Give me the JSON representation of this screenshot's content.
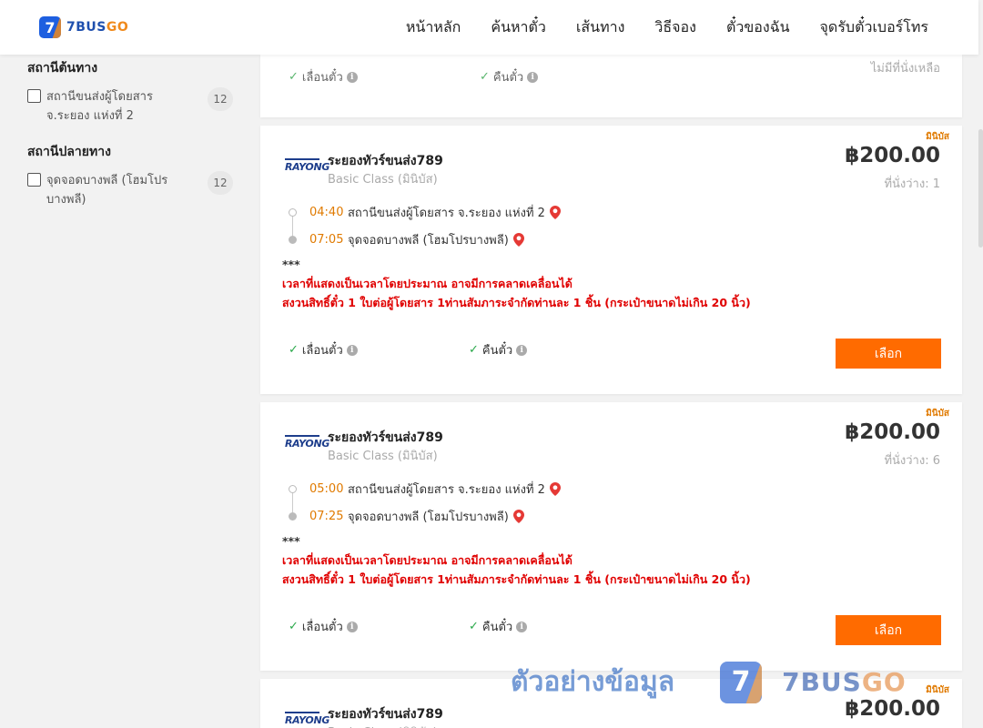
{
  "header": {
    "logo_digit": "7",
    "logo_text_main": "7BUS",
    "logo_text_accent": "GO",
    "nav": [
      "หน้าหลัก",
      "ค้นหาตั๋ว",
      "เส้นทาง",
      "วิธีจอง",
      "ตั๋วของฉัน",
      "จุดรับตั๋วเบอร์โทร"
    ]
  },
  "sidebar": {
    "origin_title": "สถานีต้นทาง",
    "origin_items": [
      {
        "label": "สถานีขนส่งผู้โดยสาร จ.ระยอง แห่งที่ 2",
        "count": "12"
      }
    ],
    "dest_title": "สถานีปลายทาง",
    "dest_items": [
      {
        "label": "จุดจอดบางพลี (โฮมโปรบางพลี)",
        "count": "12"
      }
    ]
  },
  "top_card": {
    "opt_change": "เลื่อนตั๋ว",
    "opt_refund": "คืนตั๋ว",
    "no_seat": "ไม่มีที่นั่งเหลือ"
  },
  "cards": [
    {
      "tag": "มินิบัส",
      "logo": "RAYONG",
      "operator": "ระยองทัวร์ขนส่ง789",
      "class": "Basic Class (มินิบัส)",
      "price": "฿200.00",
      "seats": "ที่นั่งว่าง: 1",
      "depart_time": "04:40",
      "depart_station": "สถานีขนส่งผู้โดยสาร จ.ระยอง แห่งที่ 2",
      "arrive_time": "07:05",
      "arrive_station": "จุดจอดบางพลี (โฮมโปรบางพลี)",
      "note_stars": "***",
      "note_line1": "เวลาที่แสดงเป็นเวลาโดยประมาณ อาจมีการคลาดเคลื่อนได้",
      "note_line2": "สงวนสิทธิ์ตั๋ว 1 ใบต่อผู้โดยสาร 1ท่านสัมภาระจำกัดท่านละ 1 ชิ้น (กระเป๋าขนาดไม่เกิน 20 นิ้ว)",
      "opt_change": "เลื่อนตั๋ว",
      "opt_refund": "คืนตั๋ว",
      "select": "เลือก"
    },
    {
      "tag": "มินิบัส",
      "logo": "RAYONG",
      "operator": "ระยองทัวร์ขนส่ง789",
      "class": "Basic Class (มินิบัส)",
      "price": "฿200.00",
      "seats": "ที่นั่งว่าง: 6",
      "depart_time": "05:00",
      "depart_station": "สถานีขนส่งผู้โดยสาร จ.ระยอง แห่งที่ 2",
      "arrive_time": "07:25",
      "arrive_station": "จุดจอดบางพลี (โฮมโปรบางพลี)",
      "note_stars": "***",
      "note_line1": "เวลาที่แสดงเป็นเวลาโดยประมาณ อาจมีการคลาดเคลื่อนได้",
      "note_line2": "สงวนสิทธิ์ตั๋ว 1 ใบต่อผู้โดยสาร 1ท่านสัมภาระจำกัดท่านละ 1 ชิ้น (กระเป๋าขนาดไม่เกิน 20 นิ้ว)",
      "opt_change": "เลื่อนตั๋ว",
      "opt_refund": "คืนตั๋ว",
      "select": "เลือก"
    },
    {
      "tag": "มินิบัส",
      "logo": "RAYONG",
      "operator": "ระยองทัวร์ขนส่ง789",
      "class": "Basic Class (มินิบัส)",
      "price": "฿200.00"
    }
  ],
  "watermark": {
    "text": "ตัวอย่างข้อมูล",
    "logo_digit": "7",
    "brand_main": "7BUS",
    "brand_accent": "GO"
  },
  "colors": {
    "accent_orange": "#ff6b00",
    "time_orange": "#e07a00",
    "warning_red": "#e00000",
    "check_green": "#2aa84a",
    "brand_blue": "#1e5fe0"
  }
}
